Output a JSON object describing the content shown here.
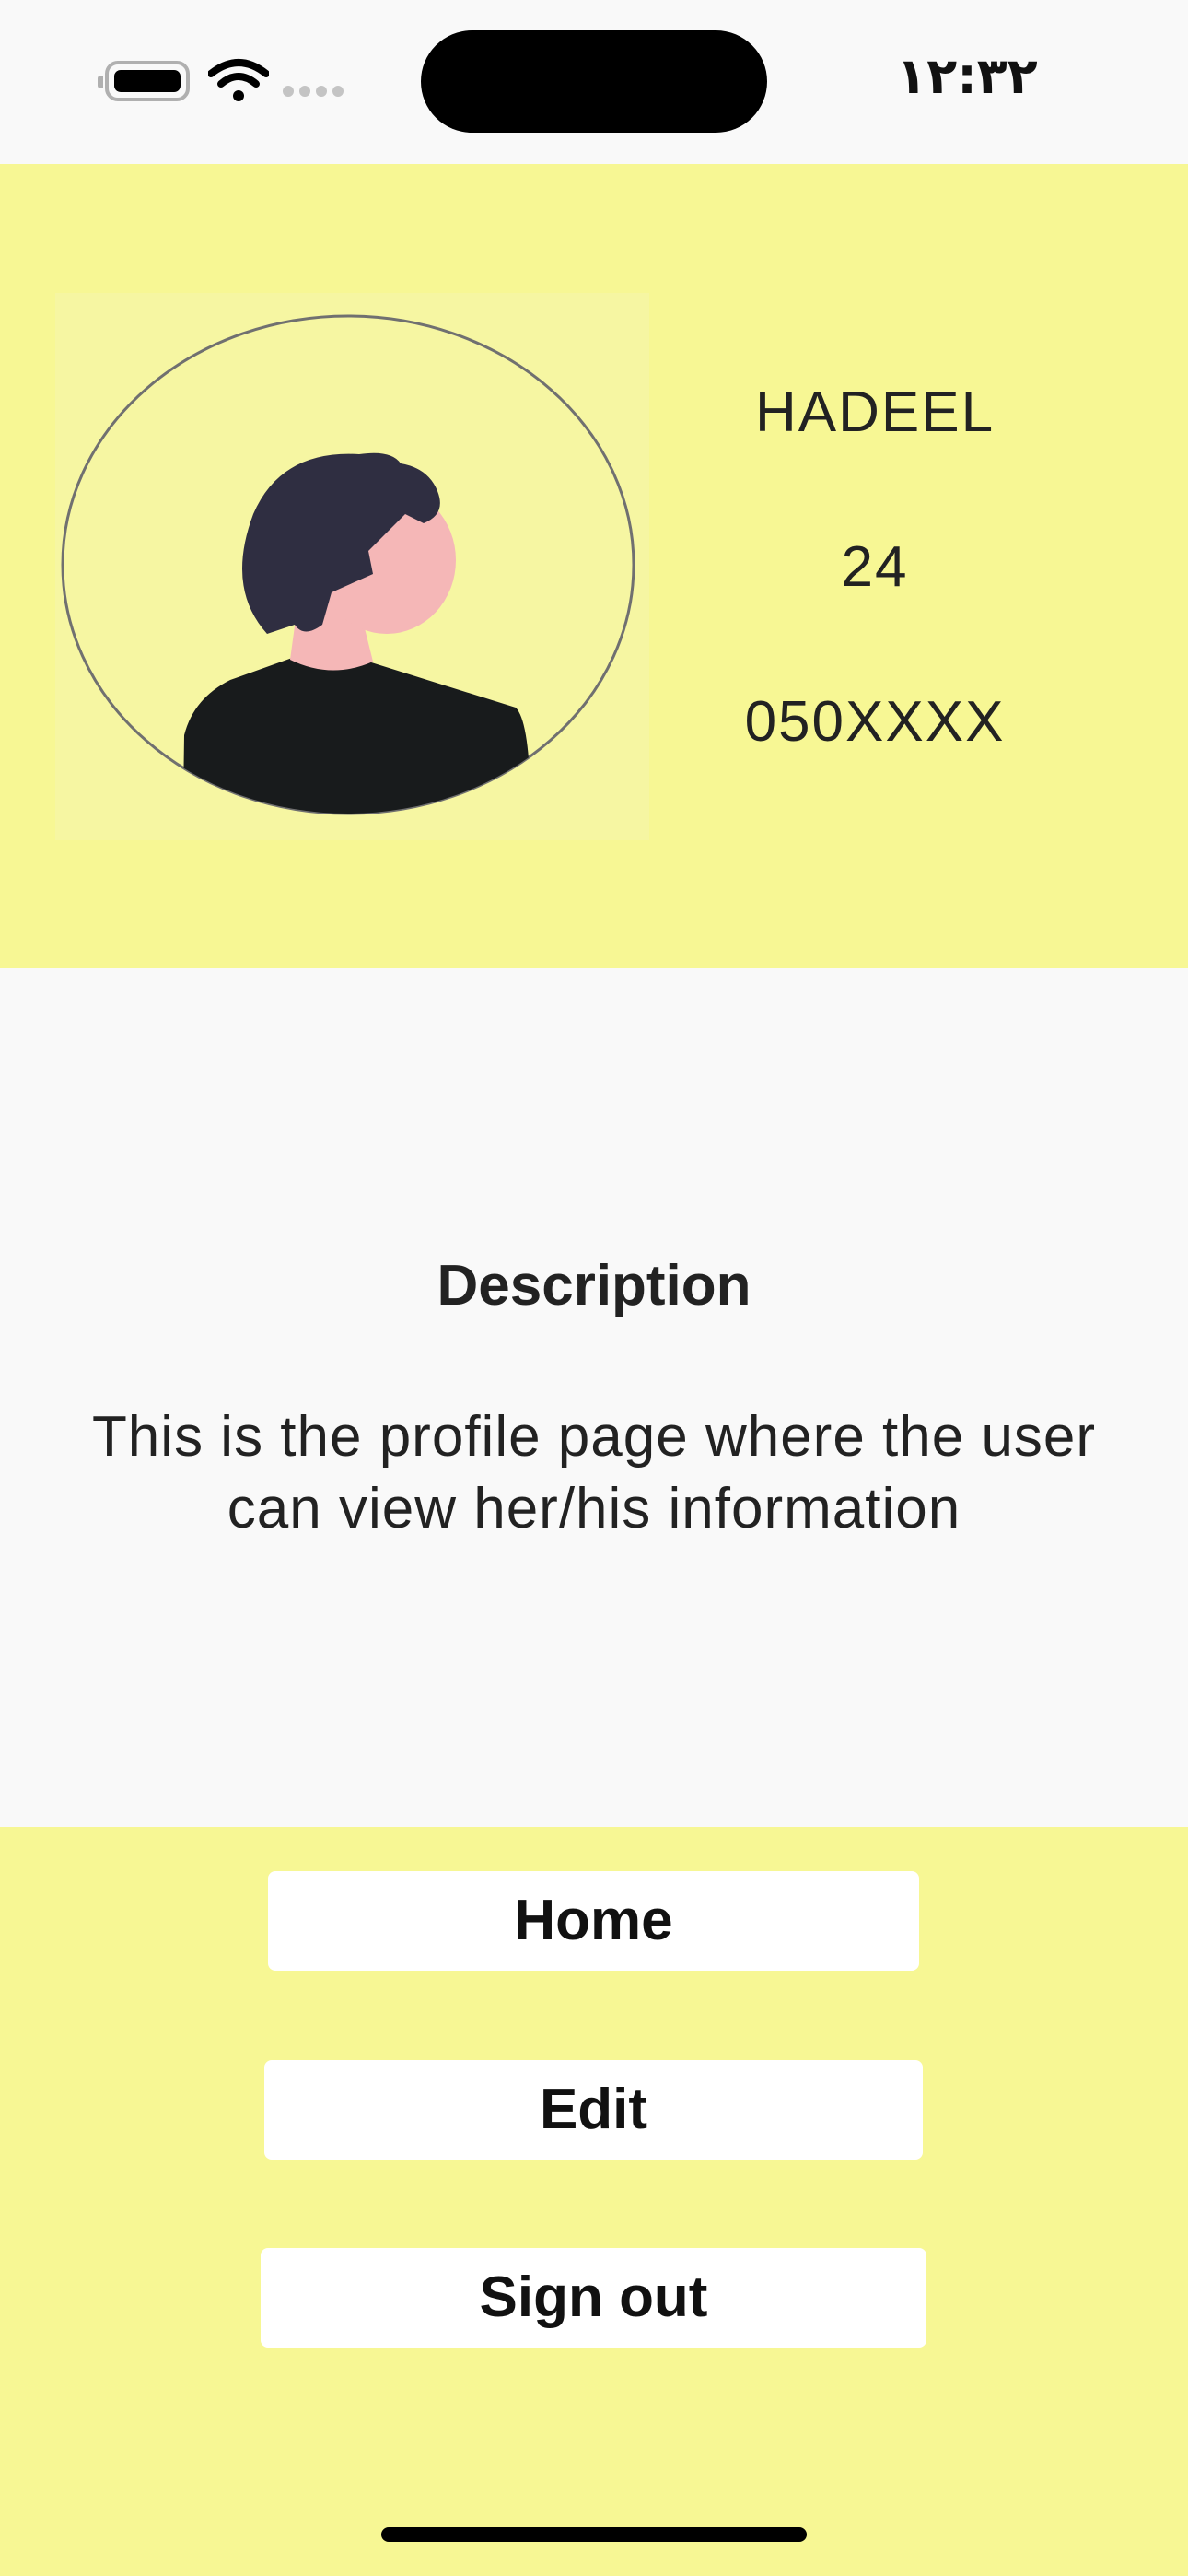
{
  "status_bar": {
    "time": "١٢:٣٢",
    "icons": [
      "battery-icon",
      "wifi-icon",
      "signal-dots-icon"
    ]
  },
  "profile": {
    "name": "HADEEL",
    "age": "24",
    "phone": "050XXXX",
    "avatar_icon": "user-avatar-icon"
  },
  "description": {
    "title": "Description",
    "body": "This is the profile page where the user can view her/his information"
  },
  "actions": {
    "home_label": "Home",
    "edit_label": "Edit",
    "signout_label": "Sign out"
  },
  "colors": {
    "accent_yellow": "#f7f794",
    "background": "#f9f9f9",
    "button_background": "#ffffff",
    "text": "#222222"
  }
}
